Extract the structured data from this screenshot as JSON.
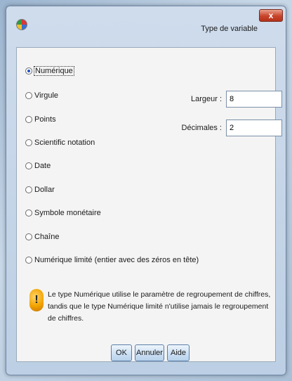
{
  "window": {
    "title": "Type de variable",
    "close_label": "x"
  },
  "options": [
    {
      "label": "Numérique",
      "checked": true
    },
    {
      "label": "Virgule",
      "checked": false
    },
    {
      "label": "Points",
      "checked": false
    },
    {
      "label": "Scientific notation",
      "checked": false
    },
    {
      "label": "Date",
      "checked": false
    },
    {
      "label": "Dollar",
      "checked": false
    },
    {
      "label": "Symbole monétaire",
      "checked": false
    },
    {
      "label": "Chaîne",
      "checked": false
    },
    {
      "label": "Numérique limité (entier avec des zéros en tête)",
      "checked": false
    }
  ],
  "width": {
    "label": "Largeur :",
    "value": "8"
  },
  "decimals": {
    "label": "Décimales :",
    "value": "2"
  },
  "info": {
    "icon": "info-icon",
    "text": "Le type Numérique utilise le paramètre de regroupement de chiffres, tandis que le type Numérique limité n'utilise jamais le regroupement de chiffres."
  },
  "buttons": {
    "ok": "OK",
    "cancel": "Annuler",
    "help": "Aide"
  }
}
